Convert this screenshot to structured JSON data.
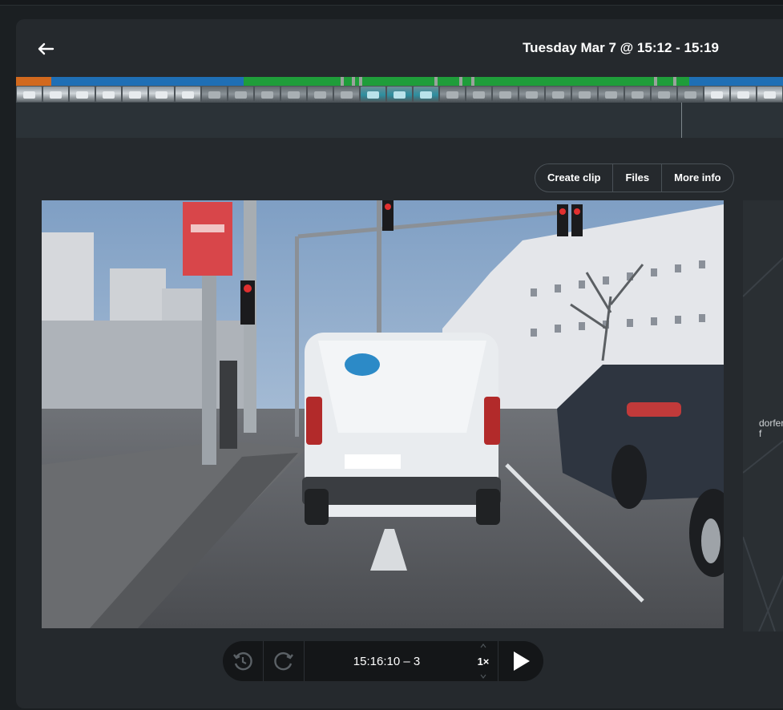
{
  "header": {
    "title": "Tuesday Mar 7 @ 15:12 - 15:19",
    "back_icon": "arrow-left-icon"
  },
  "actions": {
    "create_clip": "Create clip",
    "files": "Files",
    "more_info": "More info"
  },
  "video": {
    "plate_text": ""
  },
  "map": {
    "label_1": "dorfer",
    "label_2": "f"
  },
  "player": {
    "time": "15:16:10 – 3",
    "speed": "1×",
    "rewind_icon": "rewind-icon",
    "forward_icon": "forward-icon",
    "play_icon": "play-icon"
  },
  "colors": {
    "segment_orange": "#d2691e",
    "segment_blue": "#1f6fb5",
    "segment_green": "#1f9d3a"
  }
}
